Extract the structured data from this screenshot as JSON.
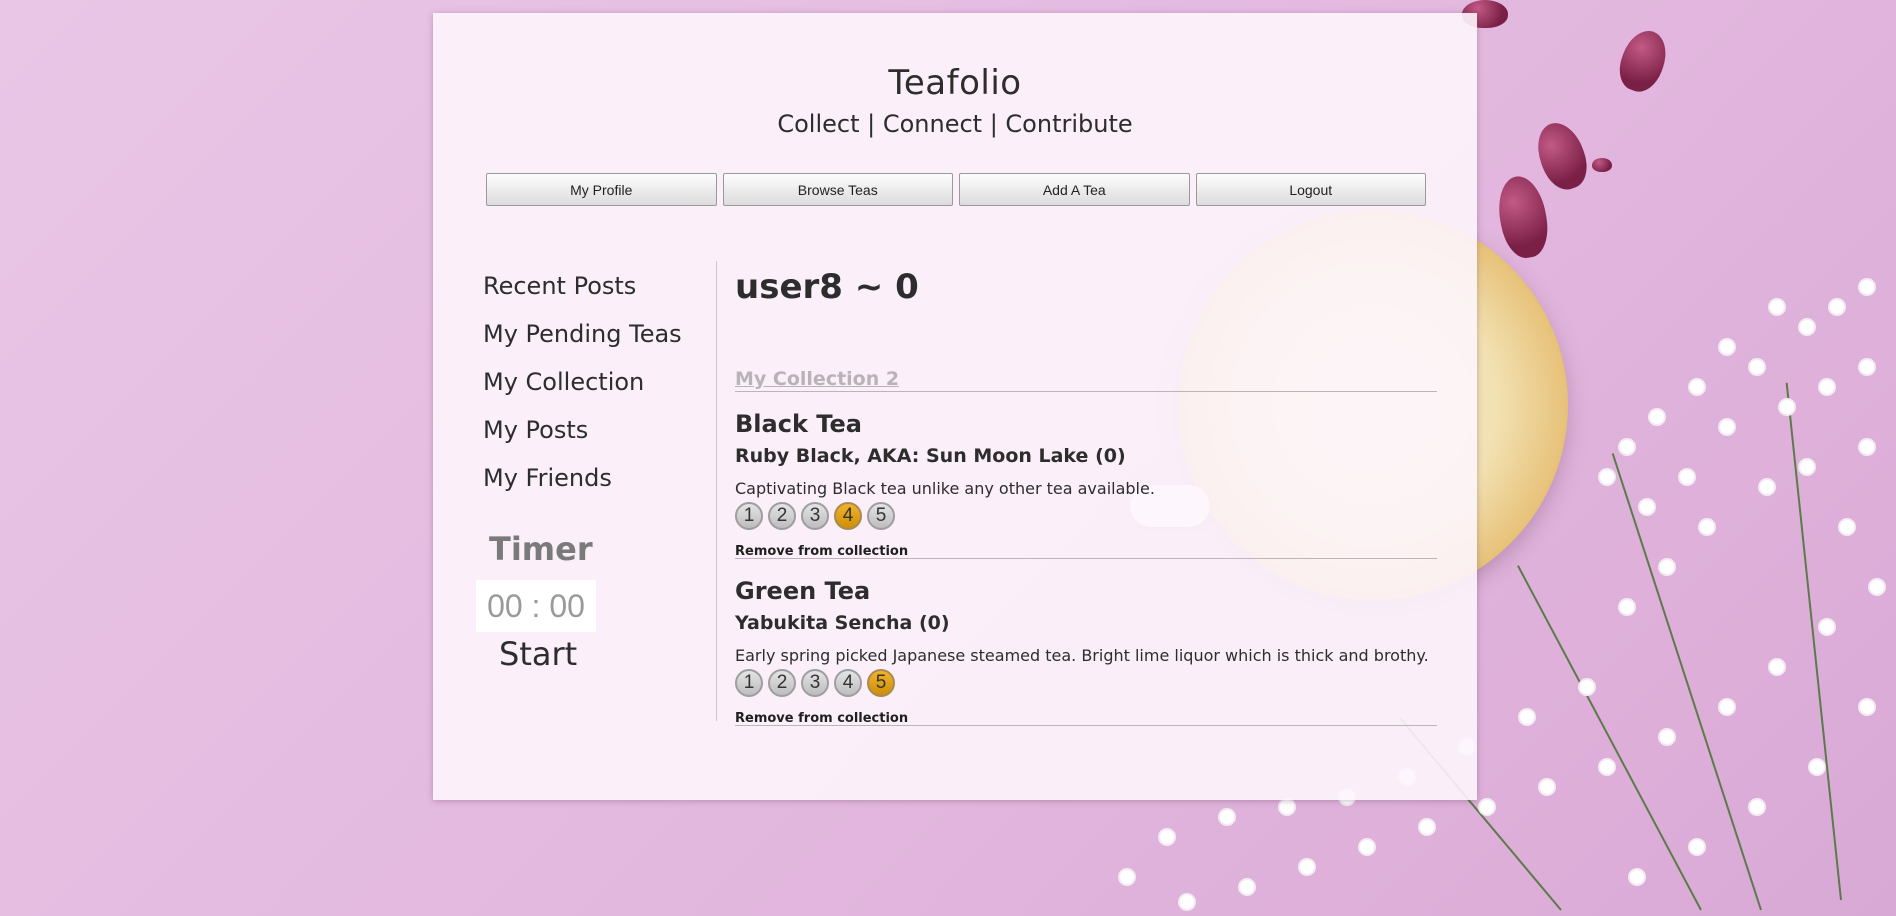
{
  "site": {
    "title": "Teafolio",
    "tagline": "Collect | Connect | Contribute"
  },
  "nav": [
    {
      "label": "My Profile"
    },
    {
      "label": "Browse Teas"
    },
    {
      "label": "Add A Tea"
    },
    {
      "label": "Logout"
    }
  ],
  "sidebar": {
    "items": [
      {
        "label": "Recent Posts"
      },
      {
        "label": "My Pending Teas"
      },
      {
        "label": "My Collection"
      },
      {
        "label": "My Posts"
      },
      {
        "label": "My Friends"
      }
    ]
  },
  "timer": {
    "title": "Timer",
    "display": "00 : 00",
    "start_label": "Start"
  },
  "profile": {
    "heading": "user8 ~ 0",
    "collection_label": "My Collection 2"
  },
  "teas": [
    {
      "type": "Black Tea",
      "name": "Ruby Black, AKA: Sun Moon Lake (0)",
      "description": "Captivating Black tea unlike any other tea available.",
      "rating_options": [
        "1",
        "2",
        "3",
        "4",
        "5"
      ],
      "rating_selected": 4,
      "remove_label": "Remove from collection"
    },
    {
      "type": "Green Tea",
      "name": "Yabukita Sencha (0)",
      "description": "Early spring picked Japanese steamed tea. Bright lime liquor which is thick and brothy.",
      "rating_options": [
        "1",
        "2",
        "3",
        "4",
        "5"
      ],
      "rating_selected": 5,
      "remove_label": "Remove from collection"
    }
  ],
  "colors": {
    "background": "#e3b8df",
    "rating_active": "#e0a316",
    "rating_inactive": "#cfcfcf"
  }
}
